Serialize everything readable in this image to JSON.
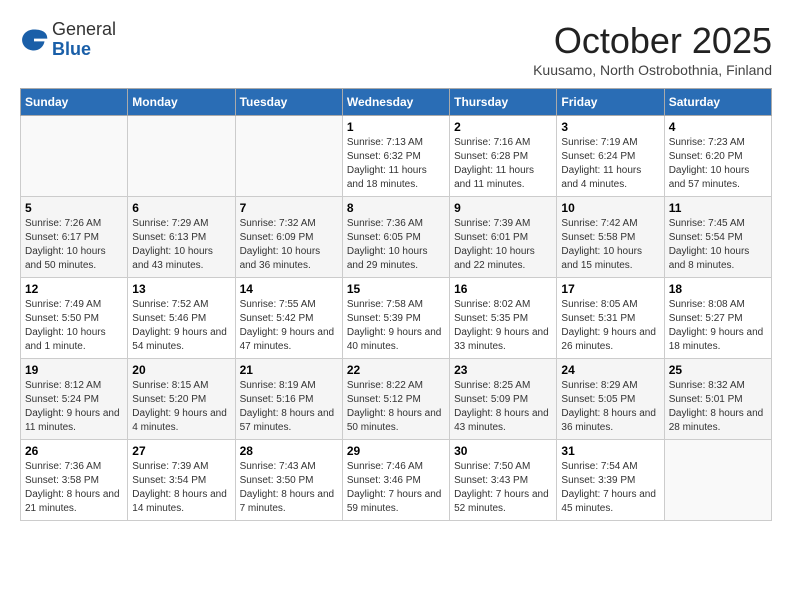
{
  "header": {
    "logo_line1": "General",
    "logo_line2": "Blue",
    "month_year": "October 2025",
    "location": "Kuusamo, North Ostrobothnia, Finland"
  },
  "days_of_week": [
    "Sunday",
    "Monday",
    "Tuesday",
    "Wednesday",
    "Thursday",
    "Friday",
    "Saturday"
  ],
  "weeks": [
    [
      {
        "day": "",
        "detail": ""
      },
      {
        "day": "",
        "detail": ""
      },
      {
        "day": "",
        "detail": ""
      },
      {
        "day": "1",
        "detail": "Sunrise: 7:13 AM\nSunset: 6:32 PM\nDaylight: 11 hours\nand 18 minutes."
      },
      {
        "day": "2",
        "detail": "Sunrise: 7:16 AM\nSunset: 6:28 PM\nDaylight: 11 hours\nand 11 minutes."
      },
      {
        "day": "3",
        "detail": "Sunrise: 7:19 AM\nSunset: 6:24 PM\nDaylight: 11 hours\nand 4 minutes."
      },
      {
        "day": "4",
        "detail": "Sunrise: 7:23 AM\nSunset: 6:20 PM\nDaylight: 10 hours\nand 57 minutes."
      }
    ],
    [
      {
        "day": "5",
        "detail": "Sunrise: 7:26 AM\nSunset: 6:17 PM\nDaylight: 10 hours\nand 50 minutes."
      },
      {
        "day": "6",
        "detail": "Sunrise: 7:29 AM\nSunset: 6:13 PM\nDaylight: 10 hours\nand 43 minutes."
      },
      {
        "day": "7",
        "detail": "Sunrise: 7:32 AM\nSunset: 6:09 PM\nDaylight: 10 hours\nand 36 minutes."
      },
      {
        "day": "8",
        "detail": "Sunrise: 7:36 AM\nSunset: 6:05 PM\nDaylight: 10 hours\nand 29 minutes."
      },
      {
        "day": "9",
        "detail": "Sunrise: 7:39 AM\nSunset: 6:01 PM\nDaylight: 10 hours\nand 22 minutes."
      },
      {
        "day": "10",
        "detail": "Sunrise: 7:42 AM\nSunset: 5:58 PM\nDaylight: 10 hours\nand 15 minutes."
      },
      {
        "day": "11",
        "detail": "Sunrise: 7:45 AM\nSunset: 5:54 PM\nDaylight: 10 hours\nand 8 minutes."
      }
    ],
    [
      {
        "day": "12",
        "detail": "Sunrise: 7:49 AM\nSunset: 5:50 PM\nDaylight: 10 hours\nand 1 minute."
      },
      {
        "day": "13",
        "detail": "Sunrise: 7:52 AM\nSunset: 5:46 PM\nDaylight: 9 hours\nand 54 minutes."
      },
      {
        "day": "14",
        "detail": "Sunrise: 7:55 AM\nSunset: 5:42 PM\nDaylight: 9 hours\nand 47 minutes."
      },
      {
        "day": "15",
        "detail": "Sunrise: 7:58 AM\nSunset: 5:39 PM\nDaylight: 9 hours\nand 40 minutes."
      },
      {
        "day": "16",
        "detail": "Sunrise: 8:02 AM\nSunset: 5:35 PM\nDaylight: 9 hours\nand 33 minutes."
      },
      {
        "day": "17",
        "detail": "Sunrise: 8:05 AM\nSunset: 5:31 PM\nDaylight: 9 hours\nand 26 minutes."
      },
      {
        "day": "18",
        "detail": "Sunrise: 8:08 AM\nSunset: 5:27 PM\nDaylight: 9 hours\nand 18 minutes."
      }
    ],
    [
      {
        "day": "19",
        "detail": "Sunrise: 8:12 AM\nSunset: 5:24 PM\nDaylight: 9 hours\nand 11 minutes."
      },
      {
        "day": "20",
        "detail": "Sunrise: 8:15 AM\nSunset: 5:20 PM\nDaylight: 9 hours\nand 4 minutes."
      },
      {
        "day": "21",
        "detail": "Sunrise: 8:19 AM\nSunset: 5:16 PM\nDaylight: 8 hours\nand 57 minutes."
      },
      {
        "day": "22",
        "detail": "Sunrise: 8:22 AM\nSunset: 5:12 PM\nDaylight: 8 hours\nand 50 minutes."
      },
      {
        "day": "23",
        "detail": "Sunrise: 8:25 AM\nSunset: 5:09 PM\nDaylight: 8 hours\nand 43 minutes."
      },
      {
        "day": "24",
        "detail": "Sunrise: 8:29 AM\nSunset: 5:05 PM\nDaylight: 8 hours\nand 36 minutes."
      },
      {
        "day": "25",
        "detail": "Sunrise: 8:32 AM\nSunset: 5:01 PM\nDaylight: 8 hours\nand 28 minutes."
      }
    ],
    [
      {
        "day": "26",
        "detail": "Sunrise: 7:36 AM\nSunset: 3:58 PM\nDaylight: 8 hours\nand 21 minutes."
      },
      {
        "day": "27",
        "detail": "Sunrise: 7:39 AM\nSunset: 3:54 PM\nDaylight: 8 hours\nand 14 minutes."
      },
      {
        "day": "28",
        "detail": "Sunrise: 7:43 AM\nSunset: 3:50 PM\nDaylight: 8 hours\nand 7 minutes."
      },
      {
        "day": "29",
        "detail": "Sunrise: 7:46 AM\nSunset: 3:46 PM\nDaylight: 7 hours\nand 59 minutes."
      },
      {
        "day": "30",
        "detail": "Sunrise: 7:50 AM\nSunset: 3:43 PM\nDaylight: 7 hours\nand 52 minutes."
      },
      {
        "day": "31",
        "detail": "Sunrise: 7:54 AM\nSunset: 3:39 PM\nDaylight: 7 hours\nand 45 minutes."
      },
      {
        "day": "",
        "detail": ""
      }
    ]
  ]
}
